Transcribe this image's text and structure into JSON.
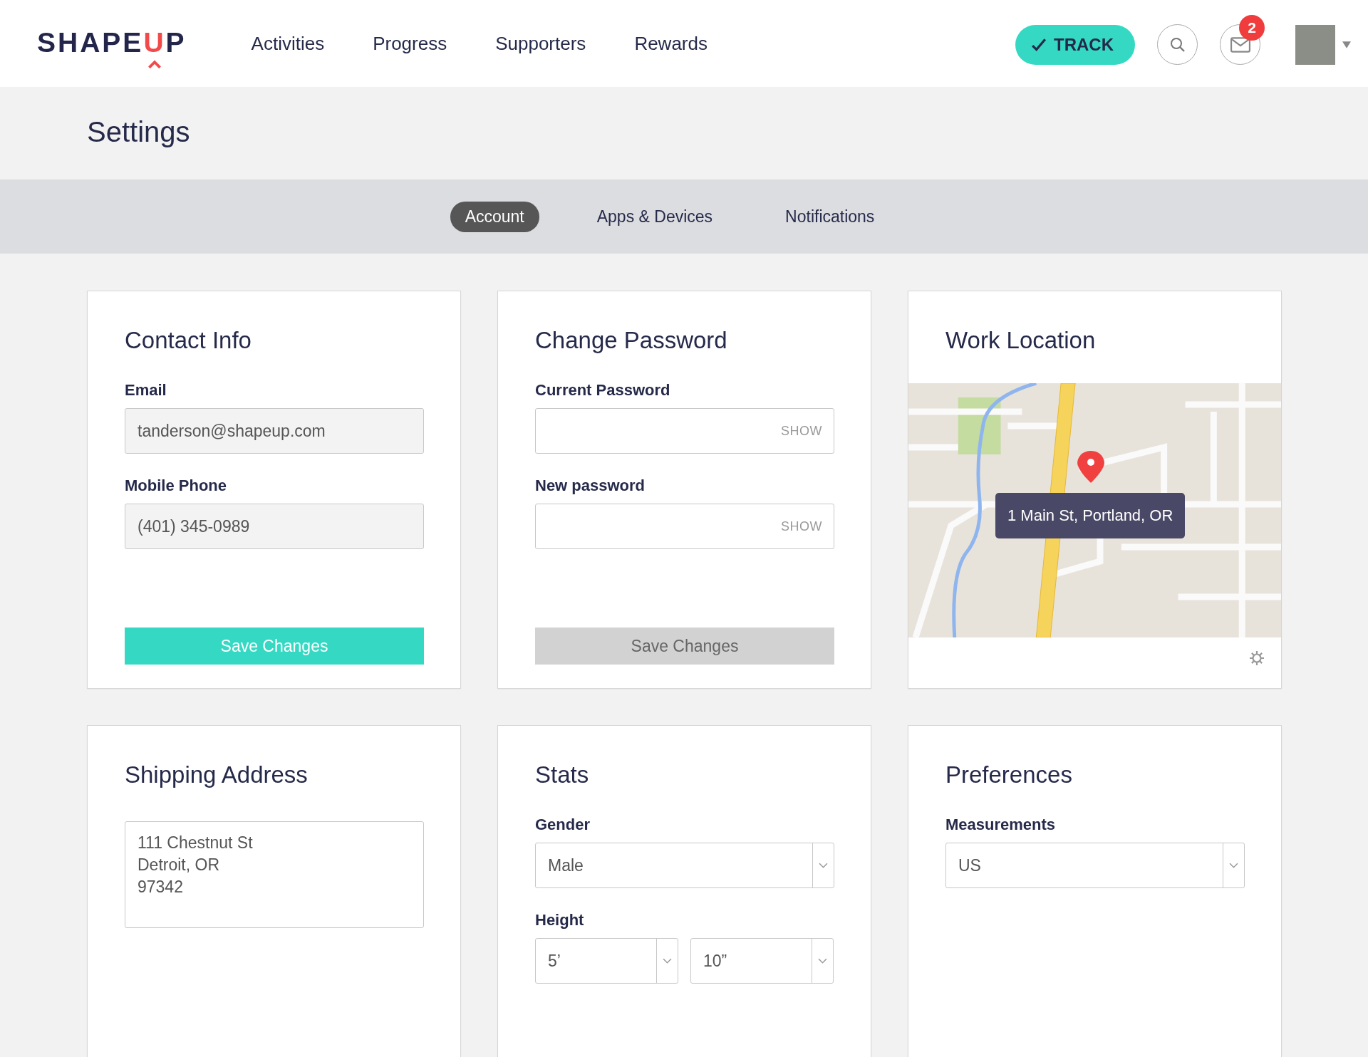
{
  "header": {
    "logo": [
      {
        "text": "SHAPE",
        "accent": false
      },
      {
        "text": "U",
        "accent": true
      },
      {
        "text": "P",
        "accent": false
      }
    ],
    "nav": [
      {
        "label": "Activities"
      },
      {
        "label": "Progress"
      },
      {
        "label": "Supporters"
      },
      {
        "label": "Rewards"
      }
    ],
    "track_button": {
      "label": "TRACK"
    },
    "messages_badge": "2"
  },
  "page_title": "Settings",
  "tabs": [
    {
      "label": "Account",
      "selected": true
    },
    {
      "label": "Apps & Devices",
      "selected": false
    },
    {
      "label": "Notifications",
      "selected": false
    }
  ],
  "cards": [
    {
      "kind": "form",
      "title": "Contact Info",
      "fields": [
        {
          "kind": "text",
          "label": "Email",
          "value": "tanderson@shapeup.com"
        },
        {
          "kind": "text",
          "label": "Mobile Phone",
          "value": "(401) 345-0989"
        }
      ],
      "button": {
        "label": "Save Changes",
        "disabled": false
      }
    },
    {
      "kind": "form",
      "title": "Change Password",
      "fields": [
        {
          "kind": "password",
          "label": "Current Password",
          "toggle": "SHOW"
        },
        {
          "kind": "password",
          "label": "New password",
          "toggle": "SHOW"
        }
      ],
      "button": {
        "label": "Save Changes",
        "disabled": true
      }
    },
    {
      "kind": "map",
      "title": "Work Location",
      "tooltip": "1 Main St, Portland, OR"
    },
    {
      "kind": "form",
      "title": "Shipping Address",
      "fields": [
        {
          "kind": "textarea",
          "lines": [
            "111 Chestnut St",
            "Detroit, OR",
            "97342"
          ]
        }
      ]
    },
    {
      "kind": "form",
      "title": "Stats",
      "fields": [
        {
          "kind": "select",
          "label": "Gender",
          "value": "Male"
        },
        {
          "kind": "select_pair",
          "label": "Height",
          "values": [
            "5’",
            "10”"
          ]
        }
      ]
    },
    {
      "kind": "form",
      "title": "Preferences",
      "fields": [
        {
          "kind": "select",
          "label": "Measurements",
          "value": "US"
        }
      ]
    }
  ]
}
